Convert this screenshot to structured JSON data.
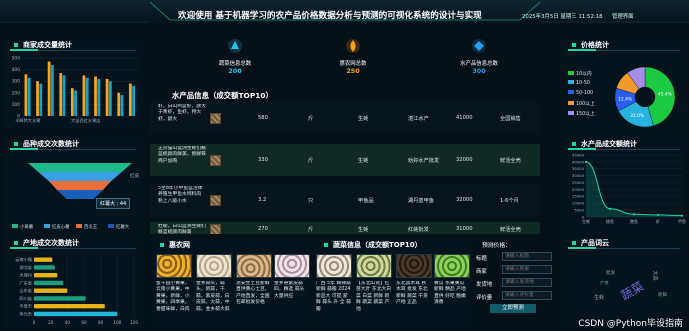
{
  "header": {
    "title": "欢迎使用 基于机器学习的农产品价格数据分析与预测的可视化系统的设计与实现",
    "datetime": "2025年3月5日 星期三 11:52:18",
    "admin_link": "管理界面"
  },
  "stats": [
    {
      "label": "蔬菜信息总数",
      "value": "200",
      "color": "#29c3ee"
    },
    {
      "label": "惠农网总数",
      "value": "250",
      "color": "#f4a21b"
    },
    {
      "label": "水产品信息总数",
      "value": "300",
      "color": "#2a9ce8"
    }
  ],
  "merchant_panel": {
    "title": "商家成交量统计",
    "chart_data": {
      "type": "bar",
      "categories": [
        "丰辉特大水果",
        "",
        "",
        "",
        "",
        "大益西红水果店",
        "",
        "",
        "",
        ""
      ],
      "series": [
        {
          "values": [
            360,
            300,
            470,
            370,
            240,
            350,
            340,
            320,
            200,
            280
          ],
          "color": "#f6a623"
        },
        {
          "values": [
            330,
            280,
            440,
            350,
            220,
            330,
            320,
            300,
            180,
            260
          ],
          "color": "#12a3c8"
        }
      ],
      "ylim": [
        0,
        500
      ],
      "yticks": [
        "0",
        "100",
        "200",
        "300",
        "400",
        "500"
      ]
    }
  },
  "variety_panel": {
    "title": "品种成交次数统计",
    "tooltip": "红薯大 : 44",
    "chart_data": {
      "type": "funnel",
      "categories": [
        "小黄薯",
        "红皮心薯",
        "西瓜王",
        "红薯大"
      ],
      "values": [
        100,
        80,
        60,
        44
      ],
      "colors": [
        "#1fb98b",
        "#3aa0e6",
        "#ec6f3b",
        "#1b5fb8"
      ]
    },
    "legend": [
      "小黄薯",
      "红皮心薯",
      "西瓜王",
      "红薯大"
    ],
    "side_label": "红皮"
  },
  "region_panel": {
    "title": "产地成交次数统计",
    "chart_data": {
      "type": "bar",
      "orientation": "horizontal",
      "categories": [
        "云南小镇",
        "湖北省",
        "大理州",
        "广东省",
        "山东省",
        "四川省",
        "平度市",
        "寿光市"
      ],
      "values": [
        22,
        25,
        28,
        35,
        40,
        62,
        85,
        100
      ],
      "xlim": [
        0,
        120
      ],
      "xticks": [
        "0",
        "20",
        "40",
        "60",
        "80",
        "100",
        "120"
      ]
    }
  },
  "aquatic_table": {
    "title": "水产品信息（成交额TOP10）",
    "rows": [
      {
        "name": "虾，白山州蓝虾，颜大于青虾，鱼虾，特大虾，颜大",
        "price": "580",
        "unit": "斤",
        "type": "生蚝",
        "origin": "湛江水产",
        "amount": "41000",
        "status": "全国销售"
      },
      {
        "name": "正宗猫山蓝洲生蚝们概蓝蚝颜肉鲜美，鲍鲜铁商户加购",
        "price": "330",
        "unit": "斤",
        "type": "生蚝",
        "origin": "劝好水产批发",
        "amount": "32000",
        "status": "鲜活全壳"
      },
      {
        "name": "5至8年小甲鱼蓝活体养殖生甲鱼水饲料肉 熟上八级小水",
        "price": "3.2",
        "unit": "只",
        "type": "甲鱼品",
        "origin": "湖丹蓝甲鱼",
        "amount": "32000",
        "status": "1-6个月"
      },
      {
        "name": "牡蛎，白山蓝洲生蚝们概蓝蚝颜肉鲜美",
        "price": "270",
        "unit": "斤",
        "type": "生蚝",
        "origin": "红蚝批发",
        "amount": "31000",
        "status": "鲜活全壳"
      }
    ]
  },
  "huinong": {
    "title": "惠农网",
    "cards": [
      {
        "text": "蜜干园小黄果，云南小黄果，中黄果，新鲜，小黄果，四季果，香甜味鲜，白肉"
      },
      {
        "text": "金乡蒜头，蒜头，新蒜，干蒜，紫皮蒜，白皮蒜，大蒜，中蒜，金乡蒜大蒜"
      },
      {
        "text": "泥安生土豆新鲜直供黄心土豆，产地直发，全国包邮批发价格"
      },
      {
        "text": "金乡县紫皮蒜 四，精选 蒜头 大量供应"
      }
    ]
  },
  "veg_table": {
    "title": "蔬菜信息（成交额TOP10）",
    "cards": [
      {
        "text": "广西 5年 鲜辣蒜 新鲜 蒜瓣 2024 新品大 可提 新鲜 蒜头 升 全 蒜瓣"
      },
      {
        "text": "【东北山货】红苗大叶 东北大白菜 白菜 新鲜 新鲜 蔬菜 蔬菜 产地"
      },
      {
        "text": "东北黑木耳 秋 木耳 批发 东北 新鲜 蔬菜 干货 产地 正品"
      },
      {
        "text": "黄瓜 水果黄瓜 新鲜 精品 产地直供 好吃 脆嫩 清香"
      }
    ]
  },
  "predict": {
    "title": "预测价格：",
    "fields": [
      {
        "label": "标题",
        "placeholder": "请输入标题"
      },
      {
        "label": "商家",
        "placeholder": "请输入商家"
      },
      {
        "label": "发货地",
        "placeholder": "请输入发货地"
      },
      {
        "label": "评价量",
        "placeholder": "请输入评价量"
      }
    ],
    "button": "立即预测"
  },
  "price_panel": {
    "title": "价格统计",
    "legend": [
      "10以内",
      "10-50",
      "50-100",
      "100以上",
      "150以上"
    ],
    "chart_data": {
      "type": "pie",
      "categories": [
        "10以内",
        "10-50",
        "50-100",
        "100以上",
        "150以上"
      ],
      "values": [
        45.4,
        22.0,
        12.4,
        10.2,
        10.0
      ],
      "labels": [
        "45.4%",
        "22.0%",
        "12.4%",
        "",
        ""
      ],
      "colors": [
        "#1cc943",
        "#27b3e0",
        "#2a5ef0",
        "#f29b2b",
        "#a58ee8"
      ]
    }
  },
  "aquatic_deal": {
    "title": "水产品成交额统计",
    "chart_data": {
      "type": "line",
      "categories": [
        "生蚝",
        "梭鱼",
        "鲍鱼",
        "虾",
        "甲鱼"
      ],
      "values": [
        40000,
        6000,
        2000,
        1500,
        1000
      ],
      "ylim": [
        0,
        45000
      ],
      "yticks": [
        "0",
        "5000",
        "10000",
        "15000",
        "20000",
        "25000",
        "30000",
        "35000",
        "40000",
        "45000"
      ]
    }
  },
  "wordcloud": {
    "title": "产品词云",
    "words": [
      "蔬菜",
      "生蚝",
      "大蒜",
      "批发",
      "新鲜",
      "产地"
    ]
  },
  "watermark": "CSDN @Python毕设指南",
  "colors": {
    "accent": "#22d3a6",
    "bg": "#061017"
  }
}
